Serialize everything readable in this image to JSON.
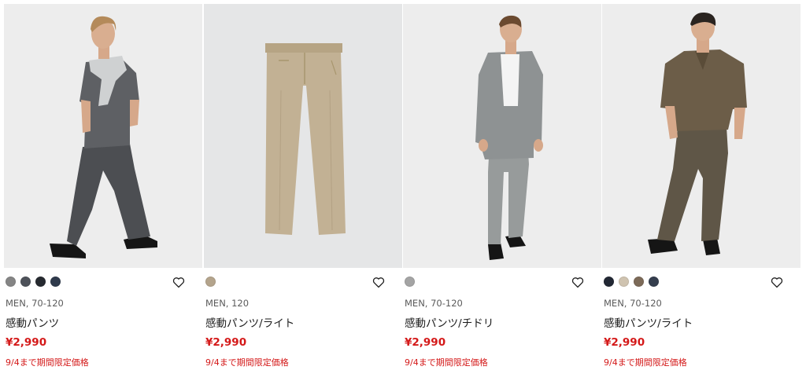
{
  "products": [
    {
      "swatches": [
        "#858585",
        "#4e525a",
        "#262a30",
        "#2f3a4c"
      ],
      "gender_sizes": "MEN, 70-120",
      "name": "感動パンツ",
      "price": "¥2,990",
      "limited": "9/4まで期間限定価格"
    },
    {
      "swatches": [
        "#b4a48c"
      ],
      "gender_sizes": "MEN, 120",
      "name": "感動パンツ/ライト",
      "price": "¥2,990",
      "limited": "9/4まで期間限定価格"
    },
    {
      "swatches": [
        "#a4a4a4"
      ],
      "gender_sizes": "MEN, 70-120",
      "name": "感動パンツ/チドリ",
      "price": "¥2,990",
      "limited": "9/4まで期間限定価格"
    },
    {
      "swatches": [
        "#222834",
        "#cfc3b0",
        "#7c6a58",
        "#353e4e"
      ],
      "gender_sizes": "MEN, 70-120",
      "name": "感動パンツ/ライト",
      "price": "¥2,990",
      "limited": "9/4まで期間限定価格"
    }
  ],
  "colors": {
    "price": "#d41919",
    "limited": "#d41919"
  },
  "icons": {
    "favorite": "heart-outline-icon"
  }
}
